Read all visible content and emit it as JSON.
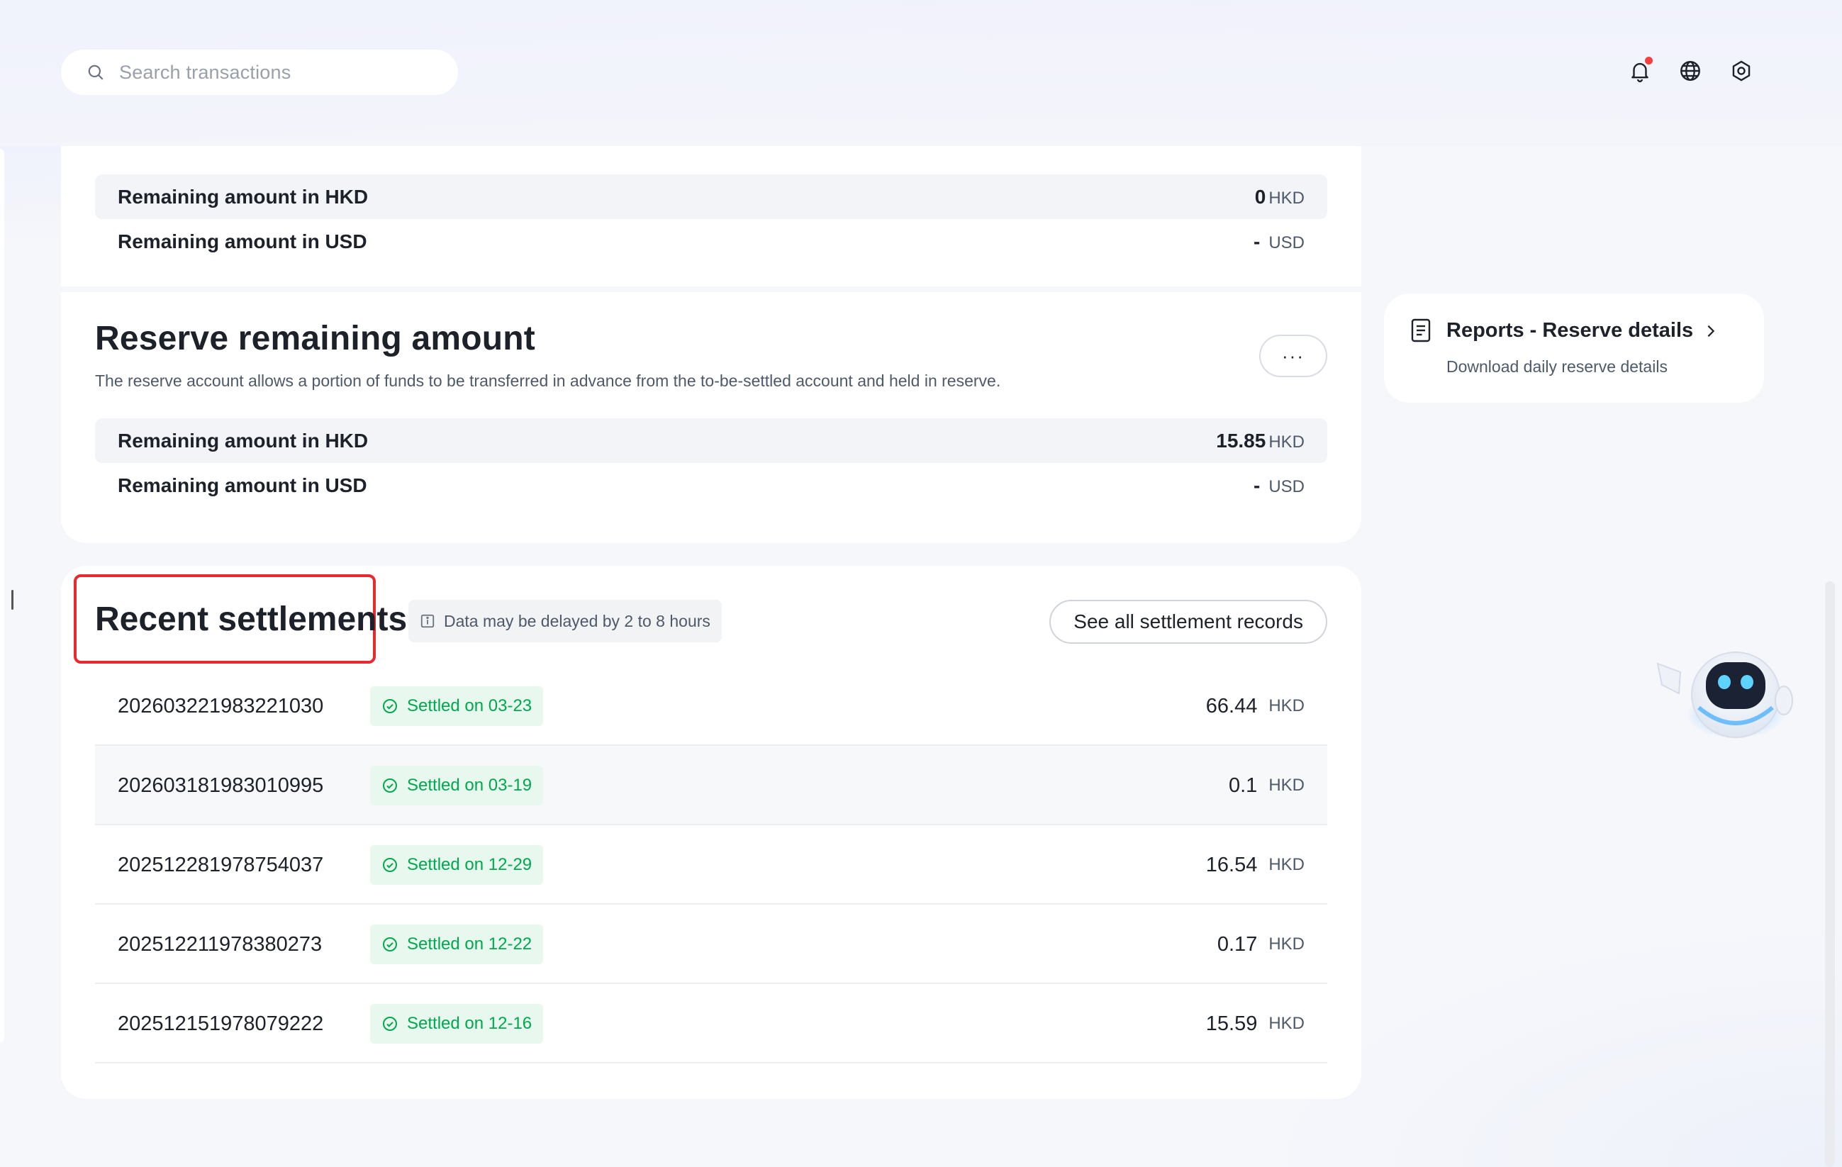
{
  "search": {
    "placeholder": "Search transactions"
  },
  "header_icons": [
    "bell-icon",
    "globe-icon",
    "settings-icon"
  ],
  "colors": {
    "accent_red": "#e8292e",
    "success_green": "#00a84f",
    "badge_green_bg": "#e8f8ee",
    "notification_dot": "#f53f3f"
  },
  "remaining_top": {
    "rows": [
      {
        "label": "Remaining amount in HKD",
        "value": "0",
        "currency": "HKD"
      },
      {
        "label": "Remaining amount in USD",
        "value": "-",
        "currency": "USD"
      }
    ]
  },
  "reserve": {
    "title": "Reserve remaining amount",
    "description": "The reserve account allows a portion of funds to be transferred in advance from the to-be-settled account and held in reserve.",
    "more_label": "···",
    "rows": [
      {
        "label": "Remaining amount in HKD",
        "value": "15.85",
        "currency": "HKD"
      },
      {
        "label": "Remaining amount in USD",
        "value": "-",
        "currency": "USD"
      }
    ]
  },
  "recent": {
    "title": "Recent settlements",
    "delay_note": "Data may be delayed by 2 to 8 hours",
    "see_all_label": "See all settlement records",
    "items": [
      {
        "id": "202603221983221030",
        "status": "Settled on 03-23",
        "amount": "66.44",
        "currency": "HKD"
      },
      {
        "id": "202603181983010995",
        "status": "Settled on 03-19",
        "amount": "0.1",
        "currency": "HKD"
      },
      {
        "id": "202512281978754037",
        "status": "Settled on 12-29",
        "amount": "16.54",
        "currency": "HKD"
      },
      {
        "id": "202512211978380273",
        "status": "Settled on 12-22",
        "amount": "0.17",
        "currency": "HKD"
      },
      {
        "id": "202512151978079222",
        "status": "Settled on 12-16",
        "amount": "15.59",
        "currency": "HKD"
      }
    ]
  },
  "report": {
    "title": "Reports - Reserve details",
    "description": "Download daily reserve details"
  }
}
